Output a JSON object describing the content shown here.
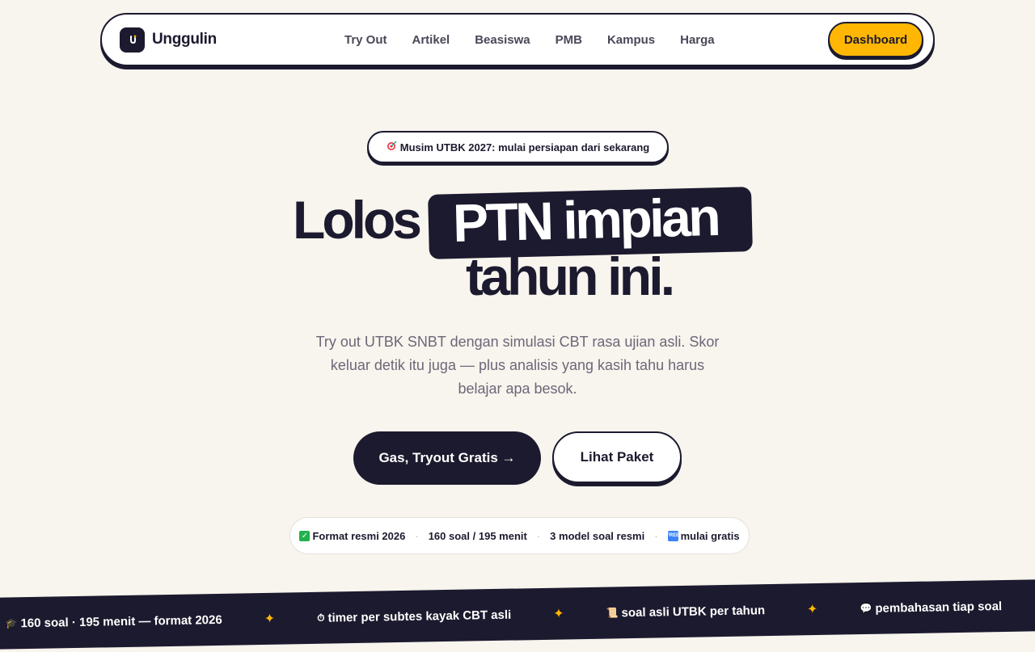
{
  "nav": {
    "brand": "Unggulin",
    "links": [
      "Try Out",
      "Artikel",
      "Beasiswa",
      "PMB",
      "Kampus",
      "Harga"
    ],
    "dashboard_label": "Dashboard"
  },
  "hero": {
    "pill": "Musim UTBK 2027: mulai persiapan dari sekarang",
    "title_part1": "Lolos",
    "title_highlight": "PTN impian",
    "title_part2": "tahun ini.",
    "subtext": "Try out UTBK SNBT dengan simulasi CBT rasa ujian asli. Skor keluar detik itu juga — plus analisis yang kasih tahu harus belajar apa besok.",
    "cta_primary": "Gas, Tryout Gratis →",
    "cta_secondary": "Lihat Paket"
  },
  "stats": [
    "Format resmi 2026",
    "160 soal / 195 menit",
    "3 model soal resmi",
    "mulai gratis"
  ],
  "ticker": [
    "160 soal · 195 menit — format 2026",
    "timer per subtes kayak CBT asli",
    "soal asli UTBK per tahun",
    "pembahasan tiap soal"
  ],
  "colors": {
    "background": "#f8f4ee",
    "dark": "#1c1a2e",
    "accent": "#ffb703"
  }
}
